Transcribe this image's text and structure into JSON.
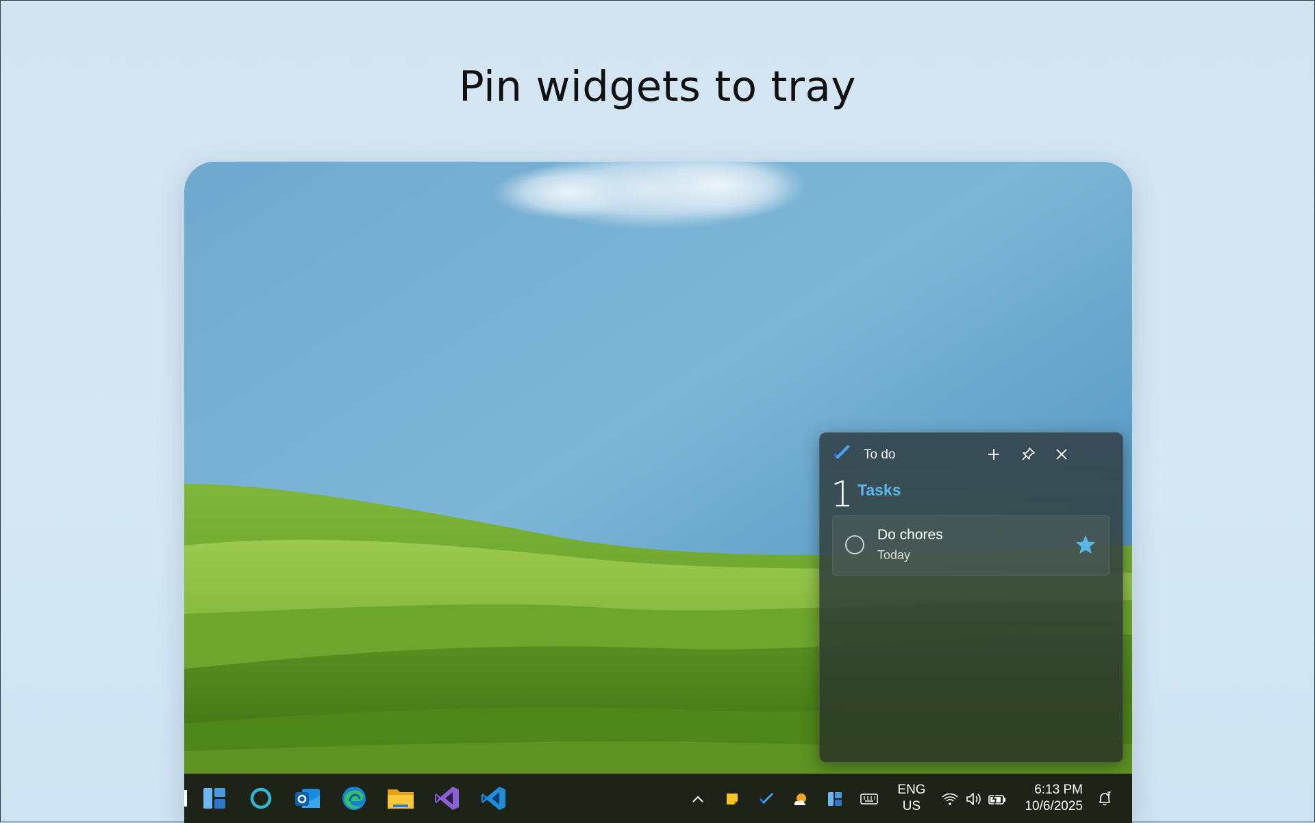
{
  "headline": "Pin widgets to tray",
  "widget": {
    "app_title": "To do",
    "count": "1",
    "list_title": "Tasks",
    "accent_color": "#5ab8e8",
    "header_icons": [
      "plus-icon",
      "pin-icon",
      "close-icon"
    ],
    "tasks": [
      {
        "title": "Do chores",
        "due": "Today",
        "starred": true
      }
    ]
  },
  "taskbar": {
    "apps": [
      "widgets-board",
      "cortana",
      "outlook",
      "edge",
      "file-explorer",
      "visual-studio",
      "vs-code"
    ],
    "tray_icons": [
      "chevron-up-icon",
      "sticky-notes-icon",
      "todo-icon",
      "weather-icon",
      "widgets-icon",
      "keyboard-icon"
    ],
    "language": {
      "line1": "ENG",
      "line2": "US"
    },
    "status_icons": [
      "wifi-icon",
      "volume-icon",
      "battery-icon"
    ],
    "clock": {
      "time": "6:13 PM",
      "date": "10/6/2025"
    }
  }
}
